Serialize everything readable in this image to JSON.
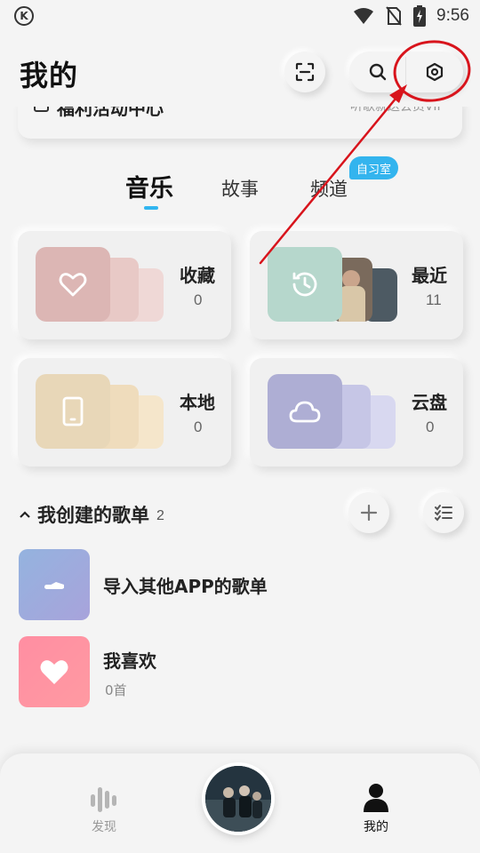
{
  "status_bar": {
    "logo": "K",
    "time": "9:56",
    "icons": [
      "wifi-icon",
      "no-sim-icon",
      "battery-charging-icon"
    ]
  },
  "header": {
    "title": "我的",
    "icons": [
      "scan-icon",
      "search-icon",
      "settings-icon"
    ]
  },
  "promo": {
    "title": "福利活动中心",
    "subtitle": "听歌就送会员VIP"
  },
  "tabs": [
    {
      "label": "音乐",
      "active": true
    },
    {
      "label": "故事",
      "active": false
    },
    {
      "label": "频道",
      "active": false
    }
  ],
  "tab_badge": "自习室",
  "cards": [
    {
      "title": "收藏",
      "count": "0",
      "icon": "heart-icon",
      "color": "#dcb6b4"
    },
    {
      "title": "最近",
      "count": "11",
      "icon": "clock-icon",
      "color": "#b6d7cc"
    },
    {
      "title": "本地",
      "count": "0",
      "icon": "phone-icon",
      "color": "#e8d7b8"
    },
    {
      "title": "云盘",
      "count": "0",
      "icon": "cloud-icon",
      "color": "#aeaed4"
    }
  ],
  "section": {
    "title": "我创建的歌单",
    "count": "2",
    "actions": [
      "add-icon",
      "manage-list-icon"
    ]
  },
  "playlists": [
    {
      "title": "导入其他APP的歌单",
      "subtitle": "",
      "icon": "import-icon"
    },
    {
      "title": "我喜欢",
      "subtitle": "0首",
      "icon": "heart-icon"
    }
  ],
  "bottom_nav": [
    {
      "label": "发现",
      "icon": "discover-bars-icon",
      "active": false
    },
    {
      "label": "我的",
      "icon": "person-icon",
      "active": true
    }
  ],
  "colors": {
    "accent": "#31b5f0",
    "annotation": "#d8141c",
    "background": "#f4f4f4"
  }
}
